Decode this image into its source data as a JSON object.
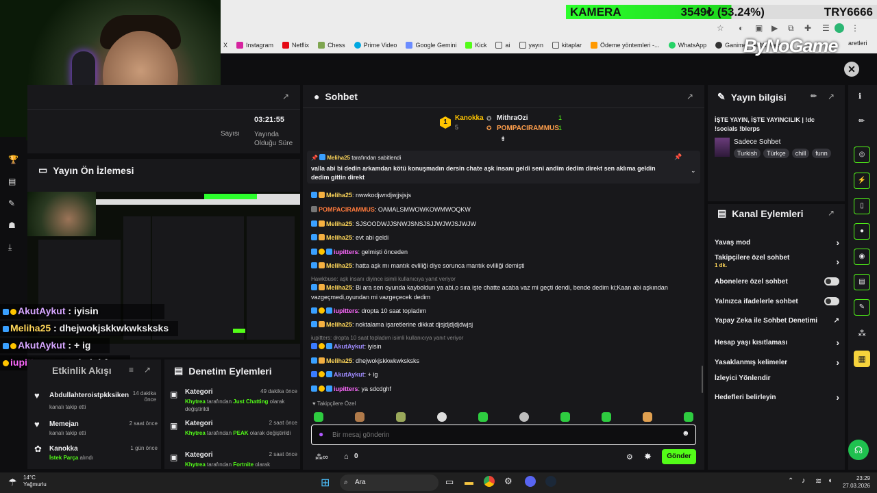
{
  "overlay": {
    "kamera_label": "KAMERA",
    "kamera_value": "3549₺ (53.24%)",
    "kamera_goal": "TRY6666",
    "brand": "ByNoGame",
    "progress_fraction": 0.5324,
    "chat": [
      {
        "name": "AkutAykut",
        "text": " : iyisin",
        "color": "#d6a6ff"
      },
      {
        "name": "Meliha25",
        "text": " : dhejwokjskkwkwksksks",
        "color": "#ffd75a"
      },
      {
        "name": "AkutAykut",
        "text": " : + ig",
        "color": "#d6a6ff"
      },
      {
        "name": "iupitters",
        "text": " : ya sdcdghf",
        "color": "#ff6aff"
      }
    ]
  },
  "bookmarks": [
    "X",
    "Instagram",
    "Netflix",
    "Chess",
    "Prime Video",
    "Google Gemini",
    "Kick",
    "ai",
    "yayın",
    "kitaplar",
    "Ödeme yöntemleri -...",
    "WhatsApp",
    "Ganimet - ARC Raid..."
  ],
  "bookmark_trailing": "aretleri",
  "stats": {
    "time": "03:21:55",
    "time_label": "Yayında Olduğu Süre",
    "count_label": "Sayısı"
  },
  "preview": {
    "title": "Yayın Ön İzlemesi"
  },
  "activity": {
    "title": "Etkinlik Akışı",
    "items": [
      {
        "name": "Abdullahteroistpkksiken",
        "sub": "kanalı takip etti",
        "time": "14 dakika önce"
      },
      {
        "name": "Memejan",
        "sub": "kanalı takip etti",
        "time": "2 saat önce"
      },
      {
        "name": "Kanokka",
        "sub_hl": "İstek Parça",
        "sub": " alındı",
        "time": "1 gün önce"
      }
    ]
  },
  "moderation": {
    "title": "Denetim Eylemleri",
    "items": [
      {
        "title": "Kategori",
        "time": "49 dakika önce",
        "user": "Khytrea",
        "mid": " tarafından ",
        "hl": "Just Chatting",
        "end": " olarak değiştirildi"
      },
      {
        "title": "Kategori",
        "time": "2 saat önce",
        "user": "Khytrea",
        "mid": " tarafından ",
        "hl": "PEAK",
        "end": " olarak değiştirildi"
      },
      {
        "title": "Kategori",
        "time": "2 saat önce",
        "user": "Khytrea",
        "mid": " tarafından ",
        "hl": "Fortnite",
        "end": " olarak"
      }
    ]
  },
  "chat": {
    "title": "Sohbet",
    "leaders": [
      {
        "name": "Kanokka",
        "count": "5",
        "rank": "1"
      },
      {
        "name": "MithraOzi",
        "count": "1"
      },
      {
        "name": "POMPACIRAMMUS",
        "count": "1"
      }
    ],
    "pinned_by": "Meliha25",
    "pinned_label": " tarafından sabitlendi",
    "pinned_text": "valla abi bi dedin arkamdan kötü konuşmadın dersin chate aşk insanı geldi seni andim dedim direkt sen aklıma geldin dedim gittin direkt",
    "messages": [
      {
        "name": "Meliha25",
        "color": "#ffd75a",
        "text": ": nwwkodjwndjwjjsjsjs"
      },
      {
        "name": "POMPACIRAMMUS",
        "color": "#ff7a3c",
        "text": ": OAMALSMWOWKOWMWOQKW"
      },
      {
        "name": "Meliha25",
        "color": "#ffd75a",
        "text": ": SJSOODWJJSNWJSNSJSJJWJWJSJWJW"
      },
      {
        "name": "Meliha25",
        "color": "#ffd75a",
        "text": ": evt abi geldi"
      },
      {
        "name": "iupitters",
        "color": "#ff6aff",
        "text": ": gelmişti önceden"
      },
      {
        "name": "Meliha25",
        "color": "#ffd75a",
        "text": ": hatta aşk mı mantık evliliği diye sorunca mantık evliliği demişti"
      }
    ],
    "reply1": "Hawkbuse: aşk insanı diyince isimli kullanıcıya yanıt veriyor",
    "msg_long_name": "Meliha25",
    "msg_long_text": ": Bi ara sen oyunda kayboldun ya abi,o sıra işte chatte acaba vaz mi geçti dendi, bende dedim ki;Kaan abi aşkından",
    "msg_long_text2": "vazgeçmedi,oyundan mi vazgeçecek dedim",
    "messages2": [
      {
        "name": "iupitters",
        "color": "#ff6aff",
        "text": ": dropta 10 saat topladım"
      },
      {
        "name": "Meliha25",
        "color": "#ffd75a",
        "text": ": noktalama işaretlerine dikkat djsjdjdjdjdwjsj"
      }
    ],
    "reply2": "iupitters: dropta 10 saat topladım isimli kullanıcıya yanıt veriyor",
    "messages3": [
      {
        "name": "AkutAykut",
        "color": "#9f8bff",
        "text": ": iyisin"
      },
      {
        "name": "Meliha25",
        "color": "#ffd75a",
        "text": ": dhejwokjskkwkwksksks"
      },
      {
        "name": "AkutAykut",
        "color": "#9f8bff",
        "text": ": + ig"
      },
      {
        "name": "iupitters",
        "color": "#ff6aff",
        "text": ": ya sdcdghf"
      }
    ],
    "followers_only": "Takipçilere Özel",
    "input_placeholder": "Bir mesaj gönderin",
    "points": "0",
    "send": "Gönder"
  },
  "info": {
    "title": "Yayın bilgisi",
    "stream_title": "İŞTE YAYIN, İŞTE YAYINCILIK | !dc !socials !blerps",
    "category": "Sadece Sohbet",
    "tags": [
      "Turkish",
      "Türkçe",
      "chill",
      "funn"
    ]
  },
  "actions": {
    "title": "Kanal Eylemleri",
    "items": [
      {
        "label": "Yavaş mod",
        "type": "chevron"
      },
      {
        "label": "Takipçilere özel sohbet",
        "sub": "1 dk.",
        "type": "chevron"
      },
      {
        "label": "Abonelere özel sohbet",
        "type": "toggle"
      },
      {
        "label": "Yalnızca ifadelerle sohbet",
        "type": "toggle"
      },
      {
        "label": "Yapay Zeka ile Sohbet Denetimi",
        "type": "ext"
      },
      {
        "label": "Hesap yaşı kısıtlaması",
        "type": "chevron"
      },
      {
        "label": "Yasaklanmış kelimeler",
        "type": "chevron"
      },
      {
        "label": "İzleyici Yönlendir",
        "type": "none"
      },
      {
        "label": "Hedefleri belirleyin",
        "type": "chevron"
      }
    ]
  },
  "taskbar": {
    "temp": "14°C",
    "weather": "Yağmurlu",
    "search": "Ara",
    "time": "23:29",
    "date": "27.03.2026"
  },
  "colors": {
    "accent": "#53fc18",
    "panel": "#18181b",
    "bg": "#0e0e10"
  }
}
